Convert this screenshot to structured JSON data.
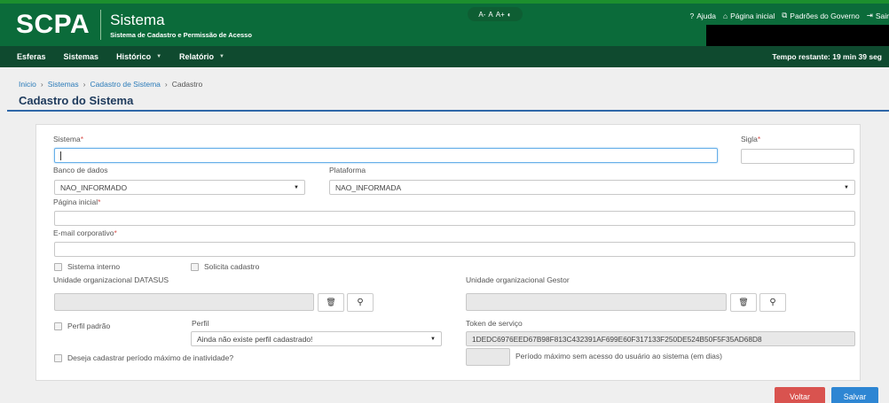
{
  "header": {
    "logo": "SCPA",
    "title": "Sistema",
    "subtitle": "Sistema de Cadastro e Permissão de Acesso",
    "accessibility": [
      "A-",
      "A",
      "A+",
      "◐"
    ],
    "links": {
      "help": "Ajuda",
      "home": "Página inicial",
      "standards": "Padrões do Governo",
      "logout": "Sair"
    }
  },
  "nav": {
    "items": [
      "Esferas",
      "Sistemas",
      "Histórico",
      "Relatório"
    ],
    "timer": "Tempo restante: 19 min 39 seg"
  },
  "breadcrumb": [
    "Inicio",
    "Sistemas",
    "Cadastro de Sistema",
    "Cadastro"
  ],
  "page_title": "Cadastro do Sistema",
  "form": {
    "sistema_label": "Sistema",
    "sistema_value": "",
    "sigla_label": "Sigla",
    "sigla_value": "",
    "banco_label": "Banco de dados",
    "banco_value": "NAO_INFORMADO",
    "plataforma_label": "Plataforma",
    "plataforma_value": "NAO_INFORMADA",
    "pagina_label": "Página inicial",
    "pagina_value": "",
    "email_label": "E-mail corporativo",
    "email_value": "",
    "sistema_interno": "Sistema interno",
    "solicita_cadastro": "Solicita cadastro",
    "unidade_datasus_label": "Unidade organizacional DATASUS",
    "unidade_gestor_label": "Unidade organizacional Gestor",
    "perfil_padrao": "Perfil padrão",
    "perfil_label": "Perfil",
    "perfil_value": "Ainda não existe perfil cadastrado!",
    "token_label": "Token de serviço",
    "token_value": "1DEDC6976EED67B98F813C432391AF699E60F317133F250DE524B50F5F35AD68D8",
    "inatividade_label": "Deseja cadastrar período máximo de inatividade?",
    "periodo_label": "Período máximo sem acesso do usuário ao sistema (em dias)",
    "periodo_value": ""
  },
  "buttons": {
    "voltar": "Voltar",
    "salvar": "Salvar"
  },
  "colors": {
    "header": "#0b6b3a",
    "nav": "#0f4a2f",
    "voltar": "#d9534f",
    "salvar": "#2e86d3"
  }
}
